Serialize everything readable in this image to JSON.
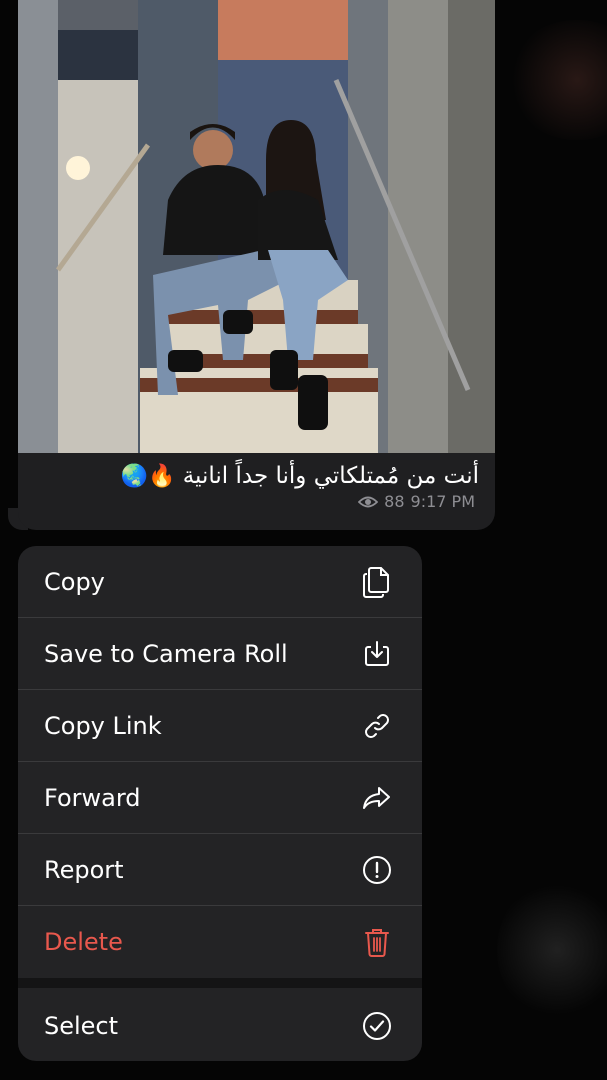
{
  "message": {
    "caption_text": "أنت من مُمتلكاتي وأنا جداً انانية",
    "caption_emojis": "🔥🌏",
    "views": "88",
    "time": "9:17 PM",
    "photo_description_icon": "photo-image"
  },
  "menu": {
    "items": [
      {
        "label": "Copy",
        "icon": "copy-icon"
      },
      {
        "label": "Save to Camera Roll",
        "icon": "save-download-icon"
      },
      {
        "label": "Copy Link",
        "icon": "link-icon"
      },
      {
        "label": "Forward",
        "icon": "forward-arrow-icon"
      },
      {
        "label": "Report",
        "icon": "report-exclamation-icon"
      },
      {
        "label": "Delete",
        "icon": "trash-icon",
        "color": "#e8584d"
      },
      {
        "label": "Select",
        "icon": "checkmark-circle-icon"
      }
    ]
  },
  "colors": {
    "background": "#050505",
    "bubble": "#1f1f21",
    "menu": "#232325",
    "danger": "#e8584d",
    "meta_text": "#8e8e93"
  }
}
